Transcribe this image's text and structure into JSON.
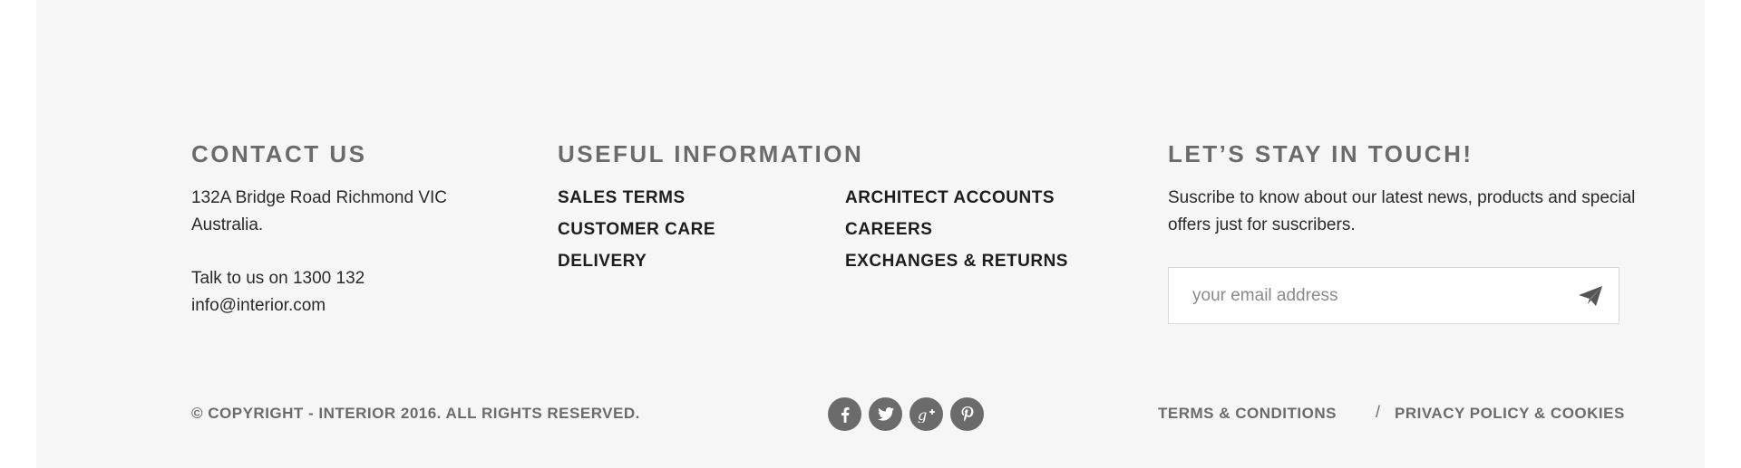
{
  "contact": {
    "heading": "CONTACT US",
    "address_line1": "132A Bridge Road Richmond VIC",
    "address_line2": "Australia.",
    "phone_line": "Talk to us on 1300 132",
    "email": "info@interior.com"
  },
  "useful": {
    "heading": "USEFUL INFORMATION",
    "links_col1": [
      "SALES TERMS",
      "CUSTOMER CARE",
      "DELIVERY"
    ],
    "links_col2": [
      "ARCHITECT ACCOUNTS",
      "CAREERS",
      "EXCHANGES & RETURNS"
    ]
  },
  "touch": {
    "heading": "LET’S STAY IN TOUCH!",
    "description": "Suscribe to know about our latest news, products and special offers just for suscribers.",
    "email_placeholder": "your email address",
    "send_icon": "paper-plane-icon"
  },
  "bottom": {
    "copyright": "© COPYRIGHT - INTERIOR 2016. ALL RIGHTS RESERVED.",
    "social_icons": [
      "facebook-icon",
      "twitter-icon",
      "google-plus-icon",
      "pinterest-icon"
    ],
    "terms_label": "TERMS & CONDITIONS",
    "separator": "/",
    "privacy_label": "PRIVACY POLICY & COOKIES"
  },
  "colors": {
    "footer_bg": "#f6f6f6",
    "heading_gray": "#6b6b6b",
    "text_dark": "#1d1d1d"
  }
}
